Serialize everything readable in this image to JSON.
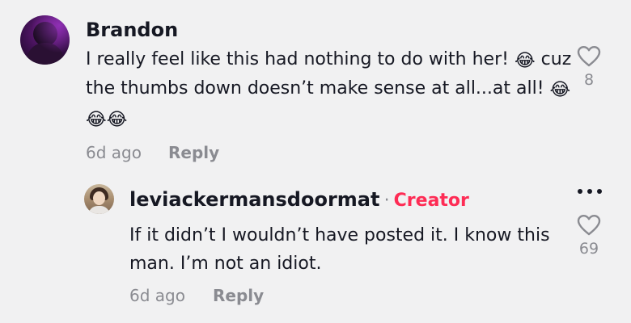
{
  "comment": {
    "username": "Brandon",
    "text_line1": "I really feel like this had nothing to do with her!",
    "text_line1_tail": "cuz",
    "text_line2": "the thumbs down doesn’t make sense at all...at all!",
    "emoji": "😂",
    "time": "6d ago",
    "reply_label": "Reply",
    "likes": "8"
  },
  "reply": {
    "username": "leviackermansdoormat",
    "separator": "·",
    "badge": "Creator",
    "text_line1": "If it didn’t I wouldn’t have posted it. I know this",
    "text_line2": "man. I’m not an idiot.",
    "time": "6d ago",
    "reply_label": "Reply",
    "likes": "69"
  },
  "icons": {
    "like": "heart-outline-icon",
    "more": "more-options-icon"
  },
  "colors": {
    "background": "#f1f1f2",
    "text": "#161823",
    "muted": "#8a8b91",
    "creator": "#fe2c55"
  }
}
